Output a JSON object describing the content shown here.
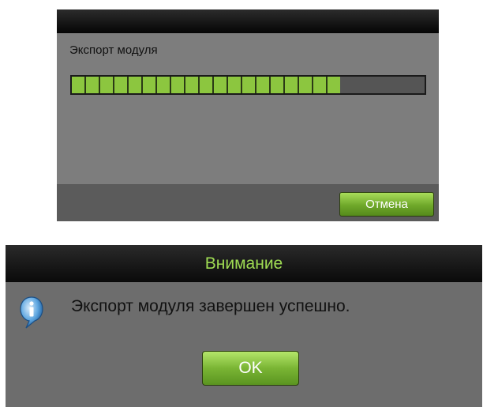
{
  "export_dialog": {
    "label": "Экспорт модуля",
    "progress_fraction": 0.76,
    "cancel_label": "Отмена",
    "colors": {
      "progress_fill": "#8cc63f",
      "button_green": "#7ab534"
    }
  },
  "attention_dialog": {
    "title": "Внимание",
    "icon": "info-icon",
    "message": "Экспорт модуля завершен успешно.",
    "ok_label": "OK",
    "colors": {
      "title_text": "#9fdc53",
      "icon_blue": "#2d7fc8"
    }
  }
}
